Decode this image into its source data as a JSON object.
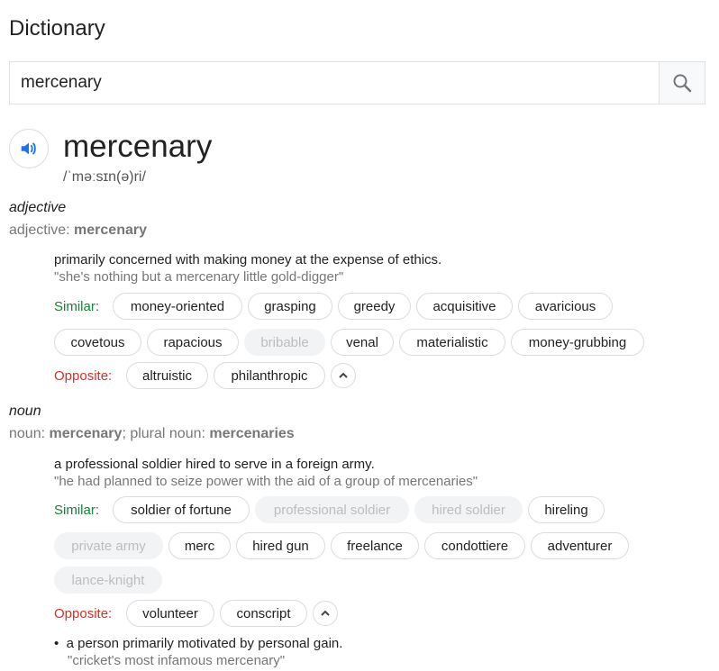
{
  "title": "Dictionary",
  "search": {
    "value": "mercenary",
    "icon": "search-icon"
  },
  "entry": {
    "word": "mercenary",
    "phonetic": "/ˈməːsɪn(ə)ri/",
    "speaker_icon": "speaker-icon"
  },
  "adjective": {
    "pos": "adjective",
    "detail_prefix": "adjective: ",
    "detail_word": "mercenary",
    "definition": "primarily concerned with making money at the expense of ethics.",
    "example": "\"she's nothing but a mercenary little gold-digger\"",
    "similar_label": "Similar:",
    "similar": [
      "money-oriented",
      "grasping",
      "greedy",
      "acquisitive",
      "avaricious",
      "covetous",
      "rapacious",
      "bribable",
      "venal",
      "materialistic",
      "money-grubbing"
    ],
    "opposite_label": "Opposite:",
    "opposite": [
      "altruistic",
      "philanthropic"
    ]
  },
  "noun": {
    "pos": "noun",
    "detail_prefix": "noun: ",
    "detail_word": "mercenary",
    "detail_mid": "; plural noun: ",
    "detail_plural": "mercenaries",
    "definition": "a professional soldier hired to serve in a foreign army.",
    "example": "\"he had planned to seize power with the aid of a group of mercenaries\"",
    "similar_label": "Similar:",
    "similar": [
      "soldier of fortune",
      "professional soldier",
      "hired soldier",
      "hireling",
      "private army",
      "merc",
      "hired gun",
      "freelance",
      "condottiere",
      "adventurer",
      "lance-knight"
    ],
    "opposite_label": "Opposite:",
    "opposite": [
      "volunteer",
      "conscript"
    ],
    "definition2": "a person primarily motivated by personal gain.",
    "example2": "\"cricket's most infamous mercenary\""
  },
  "colors": {
    "similar": "#188038",
    "opposite": "#d93025",
    "accent": "#1a73e8"
  }
}
